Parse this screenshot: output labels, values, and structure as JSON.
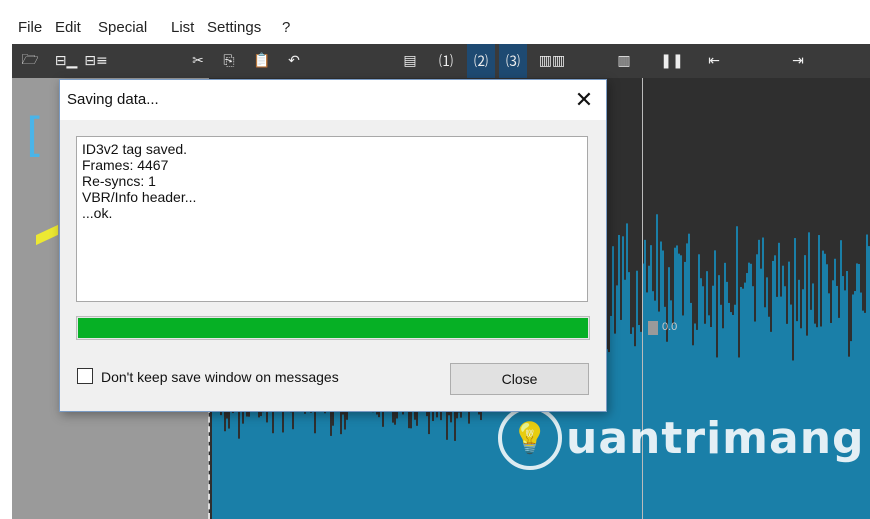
{
  "menu": [
    "File",
    "Edit",
    "Special",
    "List",
    "Settings",
    "?"
  ],
  "toolbar": {
    "icons": [
      "open-folder-icon",
      "save-tag-icon",
      "save-list-icon",
      "cut-icon",
      "copy-icon",
      "paste-icon",
      "undo-icon",
      "page-icon",
      "page-1-icon",
      "page-2-icon",
      "page-3-icon",
      "marker-left-icon",
      "marker-mid-icon",
      "pause-icon",
      "move-left-icon",
      "move-right-icon"
    ],
    "glyphs": [
      "🗁",
      "⊟▁",
      "⊟≡",
      "✂",
      "⎘",
      "📋",
      "↶",
      "▤",
      "⑴",
      "⑵",
      "⑶",
      "▥▥",
      "▥",
      "❚❚",
      "⇤",
      "⇥"
    ],
    "selected": [
      9,
      10
    ]
  },
  "waveform": {
    "marker_label": "0.0"
  },
  "watermark": {
    "text": "uantrimang",
    "icon": "lightbulb-icon",
    "glyph": "💡"
  },
  "dialog": {
    "title": "Saving data...",
    "close_glyph": "✕",
    "messages": [
      "ID3v2 tag saved.",
      "Frames: 4467",
      "Re-syncs: 1",
      "VBR/Info header...",
      "...ok."
    ],
    "progress": 1.0,
    "progress_color": "#06b025",
    "checkbox_label": "Don't keep save window on messages",
    "checkbox_checked": false,
    "close_label": "Close"
  },
  "colors": {
    "wave": "#1a7fa8",
    "accent": "#4ab4e8"
  }
}
